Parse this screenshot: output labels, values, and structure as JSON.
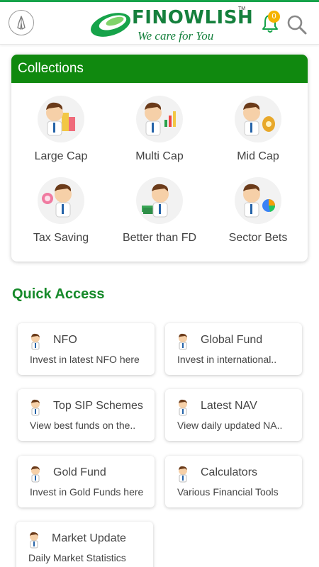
{
  "header": {
    "brand": "FINOWLISH",
    "trademark": "TM",
    "tagline": "We care for You",
    "notification_count": "0"
  },
  "collections": {
    "title": "Collections",
    "items": [
      {
        "label": "Large Cap",
        "icon": "buildings"
      },
      {
        "label": "Multi Cap",
        "icon": "chart"
      },
      {
        "label": "Mid Cap",
        "icon": "money-bag"
      },
      {
        "label": "Tax Saving",
        "icon": "percent-coin"
      },
      {
        "label": "Better than FD",
        "icon": "cash-bundle"
      },
      {
        "label": "Sector Bets",
        "icon": "pie-chart"
      }
    ]
  },
  "quick_access": {
    "title": "Quick Access",
    "cards": [
      {
        "title": "NFO",
        "subtitle": "Invest in latest NFO here"
      },
      {
        "title": "Global Fund",
        "subtitle": "Invest in international.."
      },
      {
        "title": "Top SIP Schemes",
        "subtitle": "View best funds on the.."
      },
      {
        "title": "Latest NAV",
        "subtitle": "View daily updated NA.."
      },
      {
        "title": "Gold Fund",
        "subtitle": "Invest in Gold Funds here"
      },
      {
        "title": "Calculators",
        "subtitle": "Various Financial Tools"
      },
      {
        "title": "Market Update",
        "subtitle": "Daily Market Statistics"
      }
    ]
  },
  "colors": {
    "primary_green": "#10890f",
    "badge": "#f5b400"
  }
}
